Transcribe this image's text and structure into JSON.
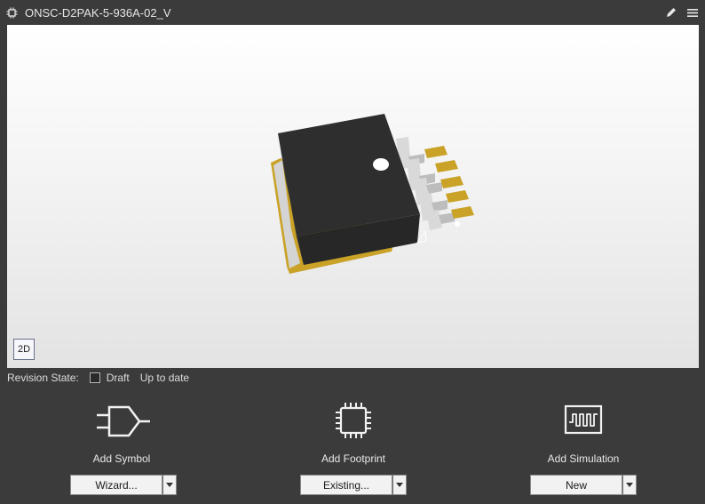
{
  "window": {
    "title": "ONSC-D2PAK-5-936A-02_V"
  },
  "viewport": {
    "view_toggle_label": "2D"
  },
  "revision": {
    "label": "Revision State:",
    "state": "Draft",
    "status": "Up to date"
  },
  "panels": [
    {
      "label": "Add Symbol",
      "button": "Wizard...",
      "icon": "symbol-icon"
    },
    {
      "label": "Add Footprint",
      "button": "Existing...",
      "icon": "chip-icon"
    },
    {
      "label": "Add Simulation",
      "button": "New",
      "icon": "waveform-icon"
    }
  ],
  "colors": {
    "background": "#3b3b3b",
    "body_dark": "#2e2e2e",
    "pad_gold": "#c9a227",
    "lead_silver": "#cfcfcf"
  }
}
